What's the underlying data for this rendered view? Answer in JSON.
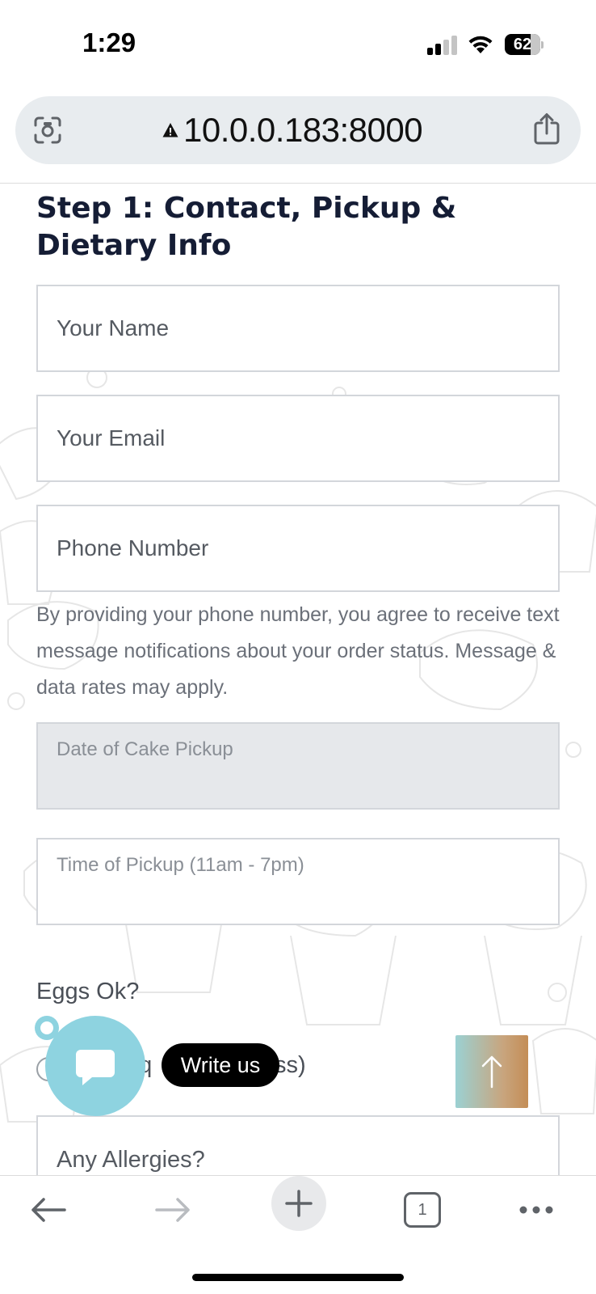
{
  "status_bar": {
    "time": "1:29",
    "battery": "62"
  },
  "browser": {
    "url": "10.0.0.183:8000"
  },
  "form": {
    "step_title": "Step 1: Contact, Pickup & Dietary Info",
    "name_placeholder": "Your Name",
    "email_placeholder": "Your Email",
    "phone_placeholder": "Phone Number",
    "phone_disclaimer": "By providing your phone number, you agree to receive text message notifications about your order status. Message & data rates may apply.",
    "pickup_date_placeholder": "Date of Cake Pickup",
    "pickup_time_placeholder": "Time of Pickup (11am - 7pm)",
    "eggs_label": "Eggs Ok?",
    "eggs_option_visible_prefix": "eq",
    "eggs_option_visible_suffix": "ss)",
    "allergies_placeholder": "Any Allergies?"
  },
  "widgets": {
    "write_us_label": "Write us"
  },
  "toolbar": {
    "tab_count": "1"
  },
  "colors": {
    "heading": "#151d35",
    "chat_accent": "#8ed3e0",
    "field_border": "#d3d6db",
    "disabled_field_bg": "#e6e8eb"
  }
}
